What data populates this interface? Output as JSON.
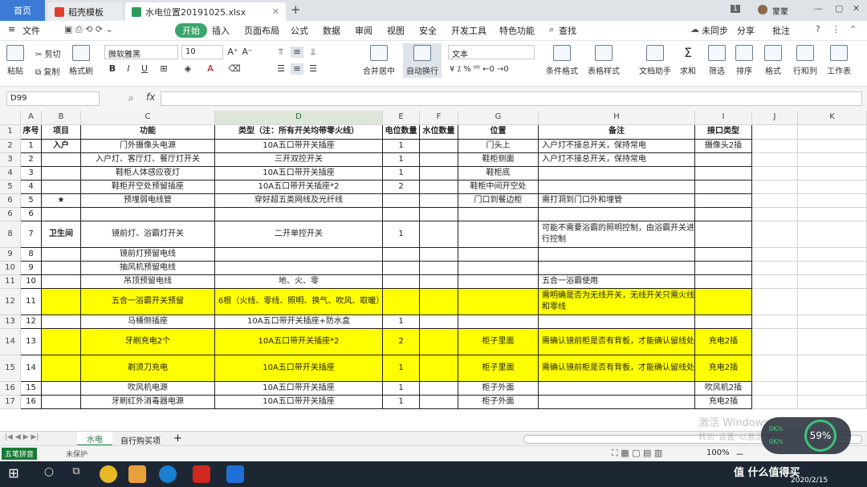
{
  "titlebar": {
    "home": "首页",
    "tab1": "稻壳模板",
    "tab2": "水电位置20191025.xlsx",
    "new_tab": "+",
    "page_count": "1",
    "user": "蒙蒙"
  },
  "menu": {
    "file": "文件",
    "start": "开始",
    "items": [
      "插入",
      "页面布局",
      "公式",
      "数据",
      "审阅",
      "视图",
      "安全",
      "开发工具",
      "特色功能"
    ],
    "search": "查找",
    "sync": "未同步",
    "share": "分享",
    "annotate": "批注"
  },
  "ribbon": {
    "paste": "粘贴",
    "cut": "剪切",
    "copy": "复制",
    "format_painter": "格式刷",
    "font": "微软雅黑",
    "size": "10",
    "merge": "合并居中",
    "wrap": "自动换行",
    "numfmt": "文本",
    "cond": "条件格式",
    "table": "表格样式",
    "doc_helper": "文档助手",
    "sum": "求和",
    "filter": "筛选",
    "sort": "排序",
    "format": "格式",
    "rowcol": "行和列",
    "sheet": "工作表"
  },
  "formula": {
    "namebox": "D99",
    "fx": "fx",
    "value": ""
  },
  "columns": [
    "A",
    "B",
    "C",
    "D",
    "E",
    "F",
    "G",
    "H",
    "I",
    "J",
    "K"
  ],
  "row_numbers": [
    "1",
    "2",
    "3",
    "4",
    "5",
    "6",
    "8",
    "8",
    "9",
    "11",
    "12",
    "13",
    "14",
    "15",
    "16",
    "17"
  ],
  "rows": [
    {
      "cells": [
        "序号",
        "项目",
        "功能",
        "类型（注：所有开关均带零火线）",
        "电位数量",
        "水位数量",
        "位置",
        "备注",
        "接口类型"
      ]
    },
    {
      "cells": [
        "1",
        "入户",
        "门外摄像头电源",
        "10A五口带开关插座",
        "1",
        "",
        "门头上",
        "入户灯不接总开关，保持常电",
        "摄像头2插"
      ]
    },
    {
      "cells": [
        "2",
        "",
        "入户灯、客厅灯、餐厅灯开关",
        "三开双控开关",
        "1",
        "",
        "鞋柜侧面",
        "入户灯不接总开关，保持常电",
        ""
      ]
    },
    {
      "cells": [
        "3",
        "",
        "鞋柜人体感应夜灯",
        "10A五口带开关插座",
        "1",
        "",
        "鞋柜底",
        "",
        ""
      ]
    },
    {
      "cells": [
        "4",
        "",
        "鞋柜开空处预留插座",
        "10A五口带开关插座*2",
        "2",
        "",
        "鞋柜中间开空处",
        "",
        ""
      ]
    },
    {
      "cells": [
        "5",
        "★",
        "预埋弱电线管",
        "穿好超五类网线及光纤线",
        "",
        "",
        "门口到餐边柜",
        "需打洞到门口外和埋管",
        ""
      ]
    },
    {
      "cells": [
        "6",
        "",
        "",
        "",
        "",
        "",
        "",
        "",
        ""
      ]
    },
    {
      "cells": [
        "7",
        "卫生间",
        "镜前灯、浴霸灯开关",
        "二开单控开关",
        "1",
        "",
        "",
        "可能不需要浴霸的照明控制，由浴霸开关进行控制",
        ""
      ]
    },
    {
      "cells": [
        "8",
        "",
        "镜前灯预留电线",
        "",
        "",
        "",
        "",
        "",
        ""
      ]
    },
    {
      "cells": [
        "9",
        "",
        "抽风机预留电线",
        "",
        "",
        "",
        "",
        "",
        ""
      ]
    },
    {
      "cells": [
        "10",
        "",
        "吊顶预留电线",
        "地、火、零",
        "",
        "",
        "",
        "五合一浴霸使用",
        ""
      ]
    },
    {
      "cells": [
        "11",
        "",
        "五合一浴霸开关预留",
        "6根（火线、零线、照明、换气、吹风、取暖）",
        "",
        "",
        "",
        "需明确是否为无线开关，无线开关只需火线和零线",
        ""
      ]
    },
    {
      "cells": [
        "12",
        "",
        "马桶侧插座",
        "10A五口带开关插座+防水盒",
        "1",
        "",
        "",
        "",
        ""
      ]
    },
    {
      "cells": [
        "13",
        "",
        "牙刷充电2个",
        "10A五口带开关插座*2",
        "2",
        "",
        "柜子里面",
        "需确认镜前柜是否有背板，才能确认留线处",
        "充电2插"
      ]
    },
    {
      "cells": [
        "14",
        "",
        "剃须刀充电",
        "10A五口带开关插座",
        "1",
        "",
        "柜子里面",
        "需确认镜前柜是否有背板，才能确认留线处",
        "充电2插"
      ]
    },
    {
      "cells": [
        "15",
        "",
        "吹风机电源",
        "10A五口带开关插座",
        "1",
        "",
        "柜子外面",
        "",
        "吹风机2插"
      ]
    },
    {
      "cells": [
        "16",
        "",
        "牙刷红外消毒器电源",
        "10A五口带开关插座",
        "1",
        "",
        "柜子外面",
        "",
        "充电2插"
      ]
    }
  ],
  "sheets": {
    "active": "水电",
    "other": "自行购买项",
    "add": "+"
  },
  "status": {
    "ime": "五笔拼音",
    "protect": "未保护",
    "zoom": "100%",
    "speed": "59%",
    "net_up": "0K/s",
    "net_down": "0K/s",
    "watermark1": "激活 Windows",
    "watermark2": "转到“设置”以激活 Windows。"
  },
  "taskbar": {
    "date": "2020/2/15",
    "brand": "值 什么值得买"
  }
}
